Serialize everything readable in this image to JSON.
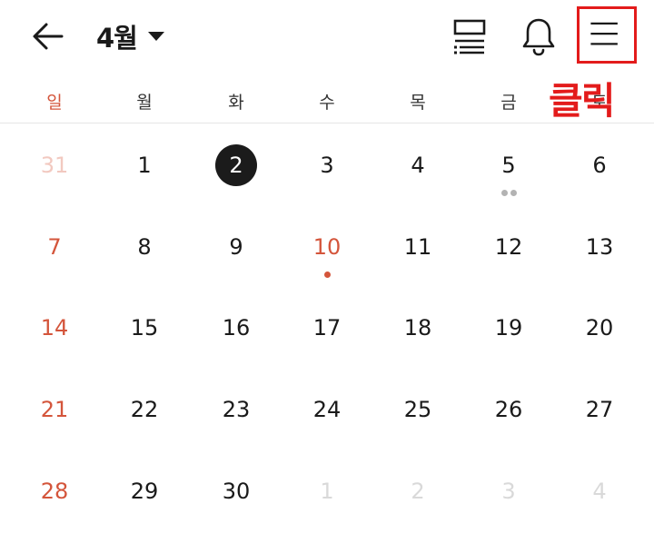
{
  "header": {
    "month_label": "4월",
    "back_icon": "arrow-left-icon",
    "list_icon": "list-view-icon",
    "bell_icon": "bell-icon",
    "menu_icon": "hamburger-menu-icon"
  },
  "annotation": {
    "text": "클릭",
    "color": "#e31b1b"
  },
  "weekdays": [
    "일",
    "월",
    "화",
    "수",
    "목",
    "금",
    "토"
  ],
  "colors": {
    "sunday": "#d4553b",
    "selected": "#1b1b1b",
    "event_gray": "#b3b3b3",
    "event_red": "#d4553b"
  },
  "weeks": [
    [
      "31",
      "1",
      "2",
      "3",
      "4",
      "5",
      "6"
    ],
    [
      "7",
      "8",
      "9",
      "10",
      "11",
      "12",
      "13"
    ],
    [
      "14",
      "15",
      "16",
      "17",
      "18",
      "19",
      "20"
    ],
    [
      "21",
      "22",
      "23",
      "24",
      "25",
      "26",
      "27"
    ],
    [
      "28",
      "29",
      "30",
      "1",
      "2",
      "3",
      "4"
    ]
  ],
  "selected_day": "2",
  "events": [
    {
      "day": "5",
      "dots": [
        "#b3b3b3",
        "#b3b3b3"
      ]
    },
    {
      "day": "10",
      "dots": [
        "#d4553b"
      ]
    }
  ]
}
